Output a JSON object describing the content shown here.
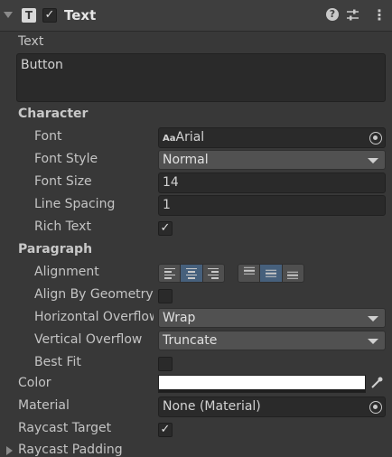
{
  "header": {
    "title": "Text",
    "component_icon_letter": "T",
    "enabled_check": "✓",
    "help_glyph": "?",
    "more_glyph": "⋮"
  },
  "text": {
    "label": "Text",
    "value": "Button"
  },
  "character": {
    "section_label": "Character",
    "font_label": "Font",
    "font_icon": "Aa",
    "font_value": "Arial",
    "font_style_label": "Font Style",
    "font_style_value": "Normal",
    "font_size_label": "Font Size",
    "font_size_value": "14",
    "line_spacing_label": "Line Spacing",
    "line_spacing_value": "1",
    "rich_text_label": "Rich Text",
    "rich_text_check": "✓"
  },
  "paragraph": {
    "section_label": "Paragraph",
    "alignment_label": "Alignment",
    "align_by_geometry_label": "Align By Geometry",
    "horizontal_overflow_label": "Horizontal Overflow",
    "horizontal_overflow_value": "Wrap",
    "vertical_overflow_label": "Vertical Overflow",
    "vertical_overflow_value": "Truncate",
    "best_fit_label": "Best Fit"
  },
  "color": {
    "label": "Color",
    "value_hex": "#ffffff"
  },
  "material": {
    "label": "Material",
    "value": "None (Material)"
  },
  "raycast_target": {
    "label": "Raycast Target",
    "check": "✓"
  },
  "raycast_padding": {
    "label": "Raycast Padding"
  }
}
